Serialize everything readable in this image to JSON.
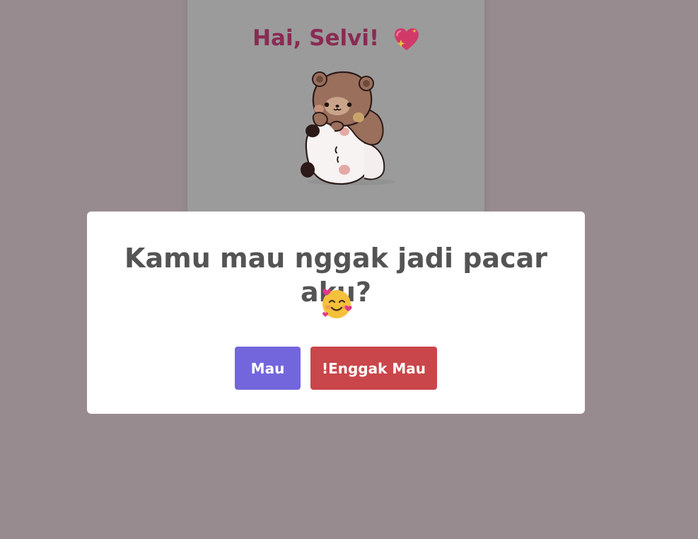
{
  "card": {
    "greeting": "Hai, Selvi!",
    "heart_icon": "sparkling-heart-emoji",
    "illustration": "bear-hugging-panda-sticker"
  },
  "modal": {
    "question": "Kamu mau nggak jadi pacar aku?",
    "emoji": "smiling-face-with-hearts-emoji",
    "yes_label": "Mau",
    "no_label": "!Enggak Mau"
  },
  "colors": {
    "overlay": "#988b90",
    "greeting": "#8a2b53",
    "yes_button": "#7366dd",
    "no_button": "#c9464a",
    "question_text": "#545454"
  }
}
